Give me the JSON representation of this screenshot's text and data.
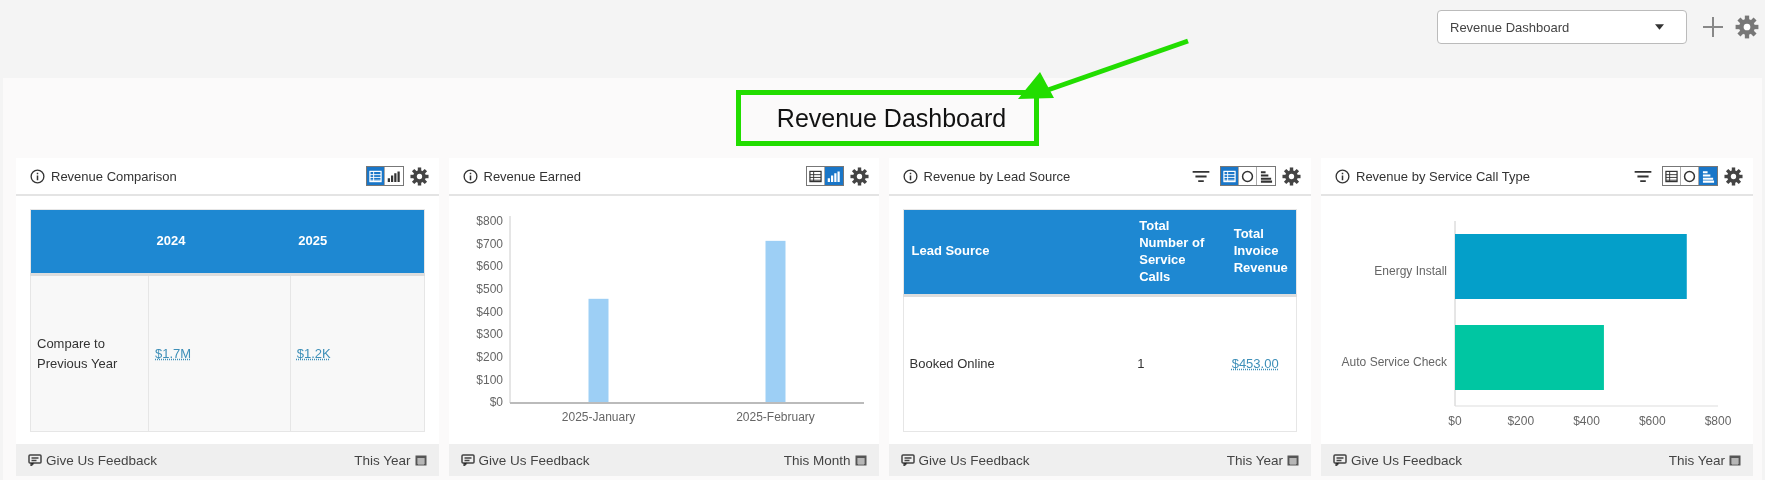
{
  "toolbar": {
    "dashboard_select": "Revenue Dashboard"
  },
  "dashboard_title": {
    "text": "Revenue Dashboard",
    "highlighted": true
  },
  "cards": [
    {
      "title": "Revenue Comparison",
      "filter": false,
      "views": [
        {
          "kind": "table",
          "selected": true
        },
        {
          "kind": "bar",
          "selected": false
        }
      ],
      "body": {
        "kind": "table",
        "shaded_rows": true,
        "columns": [
          "",
          "2024",
          "2025"
        ],
        "rows": [
          [
            {
              "text": "Compare to Previous Year",
              "link": false
            },
            {
              "text": "$1.7M",
              "link": true
            },
            {
              "text": "$1.2K",
              "link": true
            }
          ]
        ]
      },
      "feedback": "Give Us Feedback",
      "period": "This Year"
    },
    {
      "title": "Revenue Earned",
      "filter": false,
      "views": [
        {
          "kind": "table",
          "selected": false
        },
        {
          "kind": "bar",
          "selected": true
        }
      ],
      "body": {
        "kind": "chart",
        "chart_data": {
          "type": "bar",
          "orientation": "vertical",
          "categories": [
            "2025-January",
            "2025-February"
          ],
          "series": [
            {
              "color": "#9dcff5",
              "values": [
                453,
                705
              ]
            }
          ],
          "ylim": [
            0,
            800
          ],
          "yticks": [
            {
              "value": 0,
              "label": "$0"
            },
            {
              "value": 100,
              "label": "$100"
            },
            {
              "value": 200,
              "label": "$200"
            },
            {
              "value": 300,
              "label": "$300"
            },
            {
              "value": 400,
              "label": "$400"
            },
            {
              "value": 500,
              "label": "$500"
            },
            {
              "value": 600,
              "label": "$600"
            },
            {
              "value": 700,
              "label": "$700"
            },
            {
              "value": 800,
              "label": "$800"
            }
          ]
        }
      },
      "feedback": "Give Us Feedback",
      "period": "This Month"
    },
    {
      "title": "Revenue by Lead Source",
      "filter": true,
      "views": [
        {
          "kind": "table",
          "selected": true
        },
        {
          "kind": "pie",
          "selected": false
        },
        {
          "kind": "hbar",
          "selected": false
        }
      ],
      "body": {
        "kind": "table",
        "shaded_rows": false,
        "columns": [
          "Lead Source",
          "Total Number of Service Calls",
          "Total Invoice Revenue"
        ],
        "rows": [
          [
            {
              "text": "Booked Online",
              "link": false
            },
            {
              "text": "1",
              "link": false
            },
            {
              "text": "$453.00",
              "link": true
            }
          ]
        ]
      },
      "feedback": "Give Us Feedback",
      "period": "This Year"
    },
    {
      "title": "Revenue by Service Call Type",
      "filter": true,
      "views": [
        {
          "kind": "table",
          "selected": false
        },
        {
          "kind": "pie",
          "selected": false
        },
        {
          "kind": "hbar",
          "selected": true
        }
      ],
      "body": {
        "kind": "chart",
        "chart_data": {
          "type": "bar",
          "orientation": "horizontal",
          "categories": [
            "Energy Install",
            "Auto Service Check"
          ],
          "values": [
            705,
            453
          ],
          "colors": [
            "#049fc9",
            "#00c6a2"
          ],
          "xlim": [
            0,
            800
          ],
          "xticks": [
            {
              "value": 0,
              "label": "$0"
            },
            {
              "value": 200,
              "label": "$200"
            },
            {
              "value": 400,
              "label": "$400"
            },
            {
              "value": 600,
              "label": "$600"
            },
            {
              "value": 800,
              "label": "$800"
            }
          ]
        }
      },
      "feedback": "Give Us Feedback",
      "period": "This Year"
    }
  ]
}
